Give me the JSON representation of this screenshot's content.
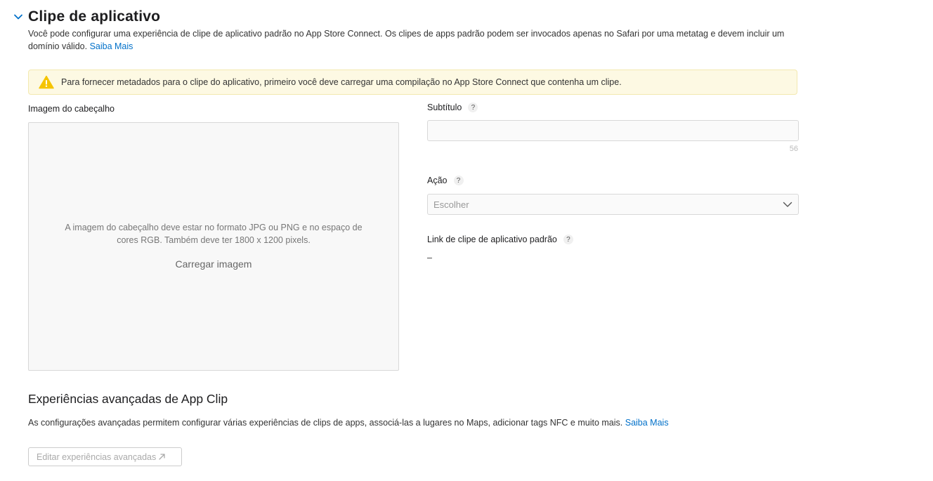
{
  "section": {
    "title": "Clipe de aplicativo",
    "chevron_icon": "chevron-down-icon",
    "description": "Você pode configurar uma experiência de clipe de aplicativo padrão no App Store Connect. Os clipes de apps padrão podem ser invocados apenas no Safari por uma metatag e devem incluir um domínio válido.",
    "learn_more": "Saiba Mais"
  },
  "warning": {
    "icon": "warning-icon",
    "text": "Para fornecer metadados para o clipe do aplicativo, primeiro você deve carregar uma compilação no App Store Connect que contenha um clipe."
  },
  "header_image": {
    "label": "Imagem do cabeçalho",
    "instructions": "A imagem do cabeçalho deve estar no formato JPG ou PNG e no espaço de cores RGB. Também deve ter 1800 x 1200 pixels.",
    "upload_label": "Carregar imagem"
  },
  "subtitle": {
    "label": "Subtítulo",
    "help": "?",
    "value": "",
    "counter": "56"
  },
  "action": {
    "label": "Ação",
    "help": "?",
    "selected": "Escolher"
  },
  "default_link": {
    "label": "Link de clipe de aplicativo padrão",
    "help": "?",
    "value": "–"
  },
  "advanced": {
    "title": "Experiências avançadas de App Clip",
    "description": "As configurações avançadas permitem configurar várias experiências de clips de apps, associá-las a lugares no Maps, adicionar tags NFC e muito mais.",
    "learn_more": "Saiba Mais",
    "edit_button": "Editar experiências avançadas"
  },
  "colors": {
    "accent": "#0070c9",
    "warning_bg": "#fdf9e3",
    "warning_icon": "#f5c400"
  }
}
